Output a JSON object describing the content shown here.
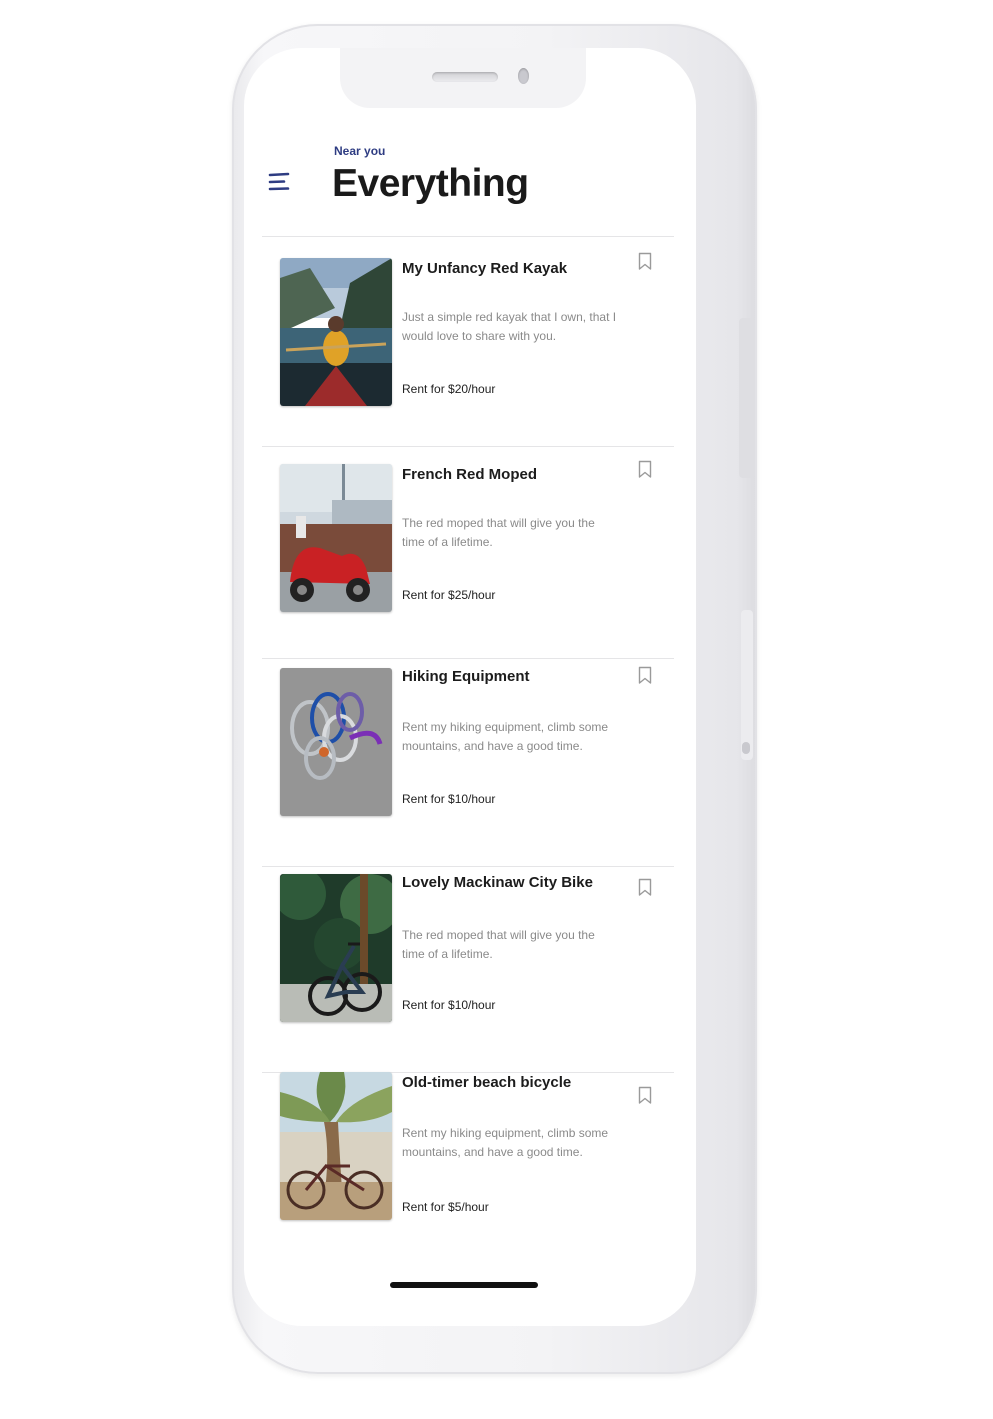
{
  "header": {
    "eyebrow": "Near you",
    "title": "Everything",
    "accent_color": "#2e3c82"
  },
  "icons": {
    "menu": "hamburger-menu-icon",
    "bookmark": "bookmark-outline-icon"
  },
  "listings": [
    {
      "title": "My Unfancy Red Kayak",
      "description": "Just a simple red kayak that I own, that I would love to share with you.",
      "price": "Rent for $20/hour",
      "image": "kayak-photo"
    },
    {
      "title": "French Red Moped",
      "description": "The red moped that will give you the time of a lifetime.",
      "price": "Rent for $25/hour",
      "image": "moped-photo"
    },
    {
      "title": "Hiking Equipment",
      "description": "Rent my hiking equipment, climb some mountains, and have a good time.",
      "price": "Rent for $10/hour",
      "image": "carabiners-photo"
    },
    {
      "title": "Lovely Mackinaw City Bike",
      "description": "The red moped that will give you the time of a lifetime.",
      "price": "Rent for $10/hour",
      "image": "bike-photo"
    },
    {
      "title": "Old-timer beach bicycle",
      "description": "Rent my hiking equipment, climb some mountains, and have a good time.",
      "price": "Rent for $5/hour",
      "image": "beach-bicycle-photo"
    }
  ]
}
